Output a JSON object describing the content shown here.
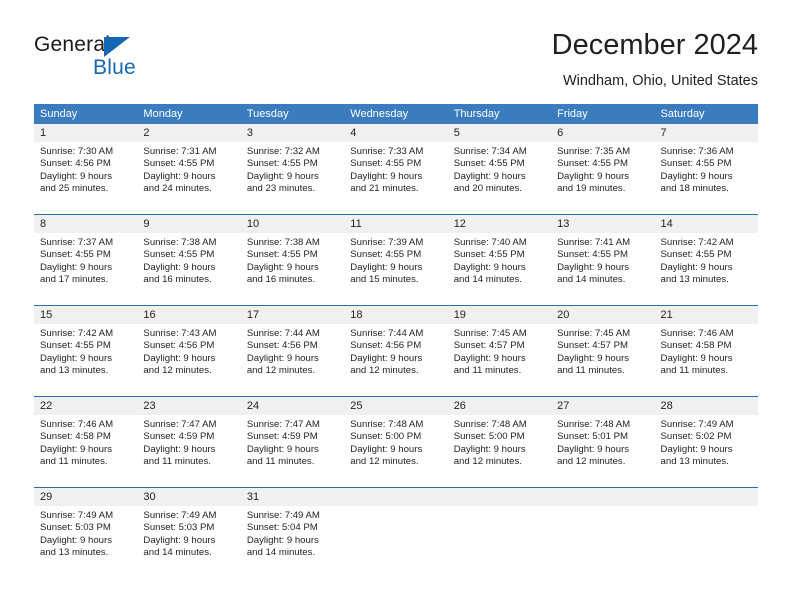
{
  "logo": {
    "word_one": "General",
    "word_two": "Blue",
    "triangle_color": "#1567b4",
    "icon": "general-blue-logo"
  },
  "header": {
    "title": "December 2024",
    "subtitle": "Windham, Ohio, United States"
  },
  "colors": {
    "header_blue": "#3a7cbe",
    "week_divider_blue": "#2c6ca8",
    "daynum_band": "#f0f0f0",
    "text": "#231f20"
  },
  "weekdays": [
    "Sunday",
    "Monday",
    "Tuesday",
    "Wednesday",
    "Thursday",
    "Friday",
    "Saturday"
  ],
  "weeks": [
    {
      "days": [
        {
          "num": "1",
          "sunrise": "Sunrise: 7:30 AM",
          "sunset": "Sunset: 4:56 PM",
          "daylight_line1": "Daylight: 9 hours",
          "daylight_line2": "and 25 minutes."
        },
        {
          "num": "2",
          "sunrise": "Sunrise: 7:31 AM",
          "sunset": "Sunset: 4:55 PM",
          "daylight_line1": "Daylight: 9 hours",
          "daylight_line2": "and 24 minutes."
        },
        {
          "num": "3",
          "sunrise": "Sunrise: 7:32 AM",
          "sunset": "Sunset: 4:55 PM",
          "daylight_line1": "Daylight: 9 hours",
          "daylight_line2": "and 23 minutes."
        },
        {
          "num": "4",
          "sunrise": "Sunrise: 7:33 AM",
          "sunset": "Sunset: 4:55 PM",
          "daylight_line1": "Daylight: 9 hours",
          "daylight_line2": "and 21 minutes."
        },
        {
          "num": "5",
          "sunrise": "Sunrise: 7:34 AM",
          "sunset": "Sunset: 4:55 PM",
          "daylight_line1": "Daylight: 9 hours",
          "daylight_line2": "and 20 minutes."
        },
        {
          "num": "6",
          "sunrise": "Sunrise: 7:35 AM",
          "sunset": "Sunset: 4:55 PM",
          "daylight_line1": "Daylight: 9 hours",
          "daylight_line2": "and 19 minutes."
        },
        {
          "num": "7",
          "sunrise": "Sunrise: 7:36 AM",
          "sunset": "Sunset: 4:55 PM",
          "daylight_line1": "Daylight: 9 hours",
          "daylight_line2": "and 18 minutes."
        }
      ]
    },
    {
      "days": [
        {
          "num": "8",
          "sunrise": "Sunrise: 7:37 AM",
          "sunset": "Sunset: 4:55 PM",
          "daylight_line1": "Daylight: 9 hours",
          "daylight_line2": "and 17 minutes."
        },
        {
          "num": "9",
          "sunrise": "Sunrise: 7:38 AM",
          "sunset": "Sunset: 4:55 PM",
          "daylight_line1": "Daylight: 9 hours",
          "daylight_line2": "and 16 minutes."
        },
        {
          "num": "10",
          "sunrise": "Sunrise: 7:38 AM",
          "sunset": "Sunset: 4:55 PM",
          "daylight_line1": "Daylight: 9 hours",
          "daylight_line2": "and 16 minutes."
        },
        {
          "num": "11",
          "sunrise": "Sunrise: 7:39 AM",
          "sunset": "Sunset: 4:55 PM",
          "daylight_line1": "Daylight: 9 hours",
          "daylight_line2": "and 15 minutes."
        },
        {
          "num": "12",
          "sunrise": "Sunrise: 7:40 AM",
          "sunset": "Sunset: 4:55 PM",
          "daylight_line1": "Daylight: 9 hours",
          "daylight_line2": "and 14 minutes."
        },
        {
          "num": "13",
          "sunrise": "Sunrise: 7:41 AM",
          "sunset": "Sunset: 4:55 PM",
          "daylight_line1": "Daylight: 9 hours",
          "daylight_line2": "and 14 minutes."
        },
        {
          "num": "14",
          "sunrise": "Sunrise: 7:42 AM",
          "sunset": "Sunset: 4:55 PM",
          "daylight_line1": "Daylight: 9 hours",
          "daylight_line2": "and 13 minutes."
        }
      ]
    },
    {
      "days": [
        {
          "num": "15",
          "sunrise": "Sunrise: 7:42 AM",
          "sunset": "Sunset: 4:55 PM",
          "daylight_line1": "Daylight: 9 hours",
          "daylight_line2": "and 13 minutes."
        },
        {
          "num": "16",
          "sunrise": "Sunrise: 7:43 AM",
          "sunset": "Sunset: 4:56 PM",
          "daylight_line1": "Daylight: 9 hours",
          "daylight_line2": "and 12 minutes."
        },
        {
          "num": "17",
          "sunrise": "Sunrise: 7:44 AM",
          "sunset": "Sunset: 4:56 PM",
          "daylight_line1": "Daylight: 9 hours",
          "daylight_line2": "and 12 minutes."
        },
        {
          "num": "18",
          "sunrise": "Sunrise: 7:44 AM",
          "sunset": "Sunset: 4:56 PM",
          "daylight_line1": "Daylight: 9 hours",
          "daylight_line2": "and 12 minutes."
        },
        {
          "num": "19",
          "sunrise": "Sunrise: 7:45 AM",
          "sunset": "Sunset: 4:57 PM",
          "daylight_line1": "Daylight: 9 hours",
          "daylight_line2": "and 11 minutes."
        },
        {
          "num": "20",
          "sunrise": "Sunrise: 7:45 AM",
          "sunset": "Sunset: 4:57 PM",
          "daylight_line1": "Daylight: 9 hours",
          "daylight_line2": "and 11 minutes."
        },
        {
          "num": "21",
          "sunrise": "Sunrise: 7:46 AM",
          "sunset": "Sunset: 4:58 PM",
          "daylight_line1": "Daylight: 9 hours",
          "daylight_line2": "and 11 minutes."
        }
      ]
    },
    {
      "days": [
        {
          "num": "22",
          "sunrise": "Sunrise: 7:46 AM",
          "sunset": "Sunset: 4:58 PM",
          "daylight_line1": "Daylight: 9 hours",
          "daylight_line2": "and 11 minutes."
        },
        {
          "num": "23",
          "sunrise": "Sunrise: 7:47 AM",
          "sunset": "Sunset: 4:59 PM",
          "daylight_line1": "Daylight: 9 hours",
          "daylight_line2": "and 11 minutes."
        },
        {
          "num": "24",
          "sunrise": "Sunrise: 7:47 AM",
          "sunset": "Sunset: 4:59 PM",
          "daylight_line1": "Daylight: 9 hours",
          "daylight_line2": "and 11 minutes."
        },
        {
          "num": "25",
          "sunrise": "Sunrise: 7:48 AM",
          "sunset": "Sunset: 5:00 PM",
          "daylight_line1": "Daylight: 9 hours",
          "daylight_line2": "and 12 minutes."
        },
        {
          "num": "26",
          "sunrise": "Sunrise: 7:48 AM",
          "sunset": "Sunset: 5:00 PM",
          "daylight_line1": "Daylight: 9 hours",
          "daylight_line2": "and 12 minutes."
        },
        {
          "num": "27",
          "sunrise": "Sunrise: 7:48 AM",
          "sunset": "Sunset: 5:01 PM",
          "daylight_line1": "Daylight: 9 hours",
          "daylight_line2": "and 12 minutes."
        },
        {
          "num": "28",
          "sunrise": "Sunrise: 7:49 AM",
          "sunset": "Sunset: 5:02 PM",
          "daylight_line1": "Daylight: 9 hours",
          "daylight_line2": "and 13 minutes."
        }
      ]
    },
    {
      "days": [
        {
          "num": "29",
          "sunrise": "Sunrise: 7:49 AM",
          "sunset": "Sunset: 5:03 PM",
          "daylight_line1": "Daylight: 9 hours",
          "daylight_line2": "and 13 minutes."
        },
        {
          "num": "30",
          "sunrise": "Sunrise: 7:49 AM",
          "sunset": "Sunset: 5:03 PM",
          "daylight_line1": "Daylight: 9 hours",
          "daylight_line2": "and 14 minutes."
        },
        {
          "num": "31",
          "sunrise": "Sunrise: 7:49 AM",
          "sunset": "Sunset: 5:04 PM",
          "daylight_line1": "Daylight: 9 hours",
          "daylight_line2": "and 14 minutes."
        },
        {
          "num": "",
          "sunrise": "",
          "sunset": "",
          "daylight_line1": "",
          "daylight_line2": ""
        },
        {
          "num": "",
          "sunrise": "",
          "sunset": "",
          "daylight_line1": "",
          "daylight_line2": ""
        },
        {
          "num": "",
          "sunrise": "",
          "sunset": "",
          "daylight_line1": "",
          "daylight_line2": ""
        },
        {
          "num": "",
          "sunrise": "",
          "sunset": "",
          "daylight_line1": "",
          "daylight_line2": ""
        }
      ]
    }
  ]
}
